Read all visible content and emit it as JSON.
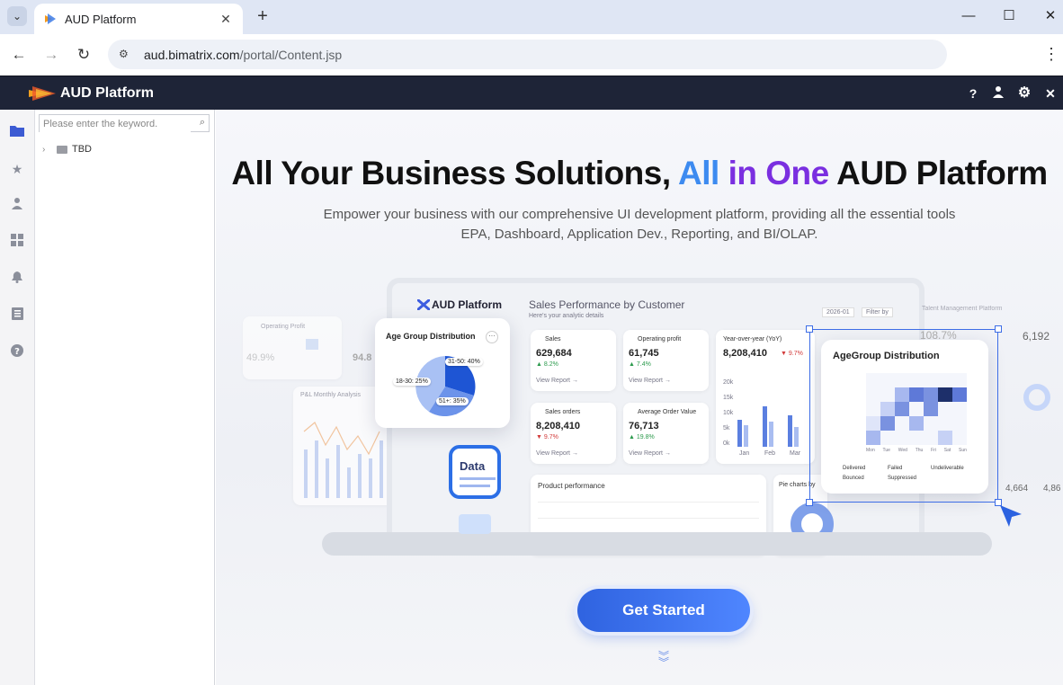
{
  "browser": {
    "tab_title": "AUD Platform",
    "url_host": "aud.bimatrix.com",
    "url_path": "/portal/Content.jsp"
  },
  "app": {
    "title": "AUD Platform"
  },
  "tree": {
    "search_placeholder": "Please enter the keyword.",
    "items": [
      {
        "label": "TBD"
      }
    ]
  },
  "hero": {
    "headline_part1": "All Your Business Solutions, ",
    "headline_part2": "All",
    "headline_part3": " in One",
    "headline_part4": " AUD Platform",
    "sub_line1": "Empower your business with our comprehensive UI development platform, providing all the essential tools",
    "sub_line2": "EPA, Dashboard, Application Dev., Reporting, and BI/OLAP.",
    "cta_label": "Get Started"
  },
  "mockup": {
    "brand": "AUD Platform",
    "title": "Sales Performance by Customer",
    "subtitle": "Here's your analytic details",
    "date_chip": "2026-01",
    "filter_chip": "Filter by",
    "age_card_title": "Age Group Distribution",
    "age_labels": [
      "31-50: 40%",
      "18-30: 25%",
      "51+: 35%"
    ],
    "data_badge": "Data",
    "kpis": [
      {
        "label": "Sales",
        "value": "629,684",
        "delta": "▲ 8.2%",
        "link": "View Report →"
      },
      {
        "label": "Operating profit",
        "value": "61,745",
        "delta": "▲ 7.4%",
        "link": "View Report →"
      },
      {
        "label": "Sales orders",
        "value": "8,208,410",
        "delta": "▼ 9.7%",
        "link": "View Report →"
      },
      {
        "label": "Average Order Value",
        "value": "76,713",
        "delta": "▲ 19.8%",
        "link": "View Report →"
      }
    ],
    "yoy_label": "Year-over-year (YoY)",
    "yoy_value": "8,208,410",
    "yoy_delta": "▼ 9.7%",
    "yoy_months": [
      "Jan",
      "Feb",
      "Mar"
    ],
    "yoy_ticks": [
      "20k",
      "15k",
      "10k",
      "5k",
      "0k"
    ],
    "product_perf": "Product performance",
    "pie_label": "Pie charts by",
    "heat_title": "AgeGroup Distribution",
    "heat_days": [
      "Mon",
      "Tue",
      "Wed",
      "Thu",
      "Fri",
      "Sat",
      "Sun"
    ],
    "heat_legend": [
      "Delivered",
      "Failed",
      "Undeliverable",
      "Bounced",
      "Suppressed"
    ],
    "left_metric": "49.9%",
    "left_metric2": "94.8",
    "left_label": "Operating Profit",
    "pl_label": "P&L Monthly Analysis",
    "right_value1": "108.7%",
    "right_value2": "6,192",
    "right_value3": "4,664",
    "right_value4": "4,86",
    "right_label": "Talent Management Platform"
  }
}
